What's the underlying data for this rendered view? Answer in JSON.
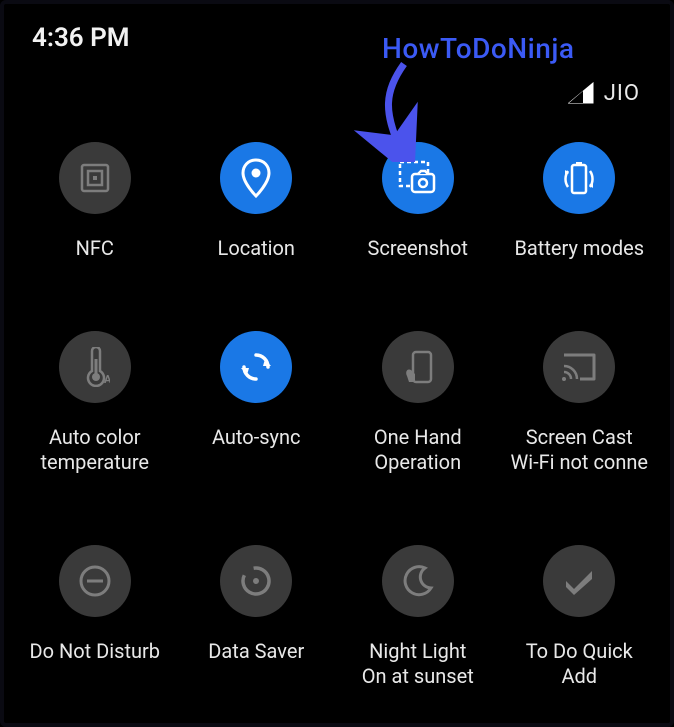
{
  "status": {
    "time": "4:36 PM"
  },
  "watermark": "HowToDoNinja",
  "signal": {
    "carrier": "JIO"
  },
  "tiles": [
    {
      "label": "NFC"
    },
    {
      "label": "Location"
    },
    {
      "label": "Screenshot"
    },
    {
      "label": "Battery modes"
    },
    {
      "label": "Auto color\ntemperature"
    },
    {
      "label": "Auto-sync"
    },
    {
      "label": "One Hand\nOperation"
    },
    {
      "label": "Screen Cast\nWi-Fi not conne"
    },
    {
      "label": "Do Not Disturb"
    },
    {
      "label": "Data Saver"
    },
    {
      "label": "Night Light\nOn at sunset"
    },
    {
      "label": "To Do Quick\nAdd"
    }
  ]
}
